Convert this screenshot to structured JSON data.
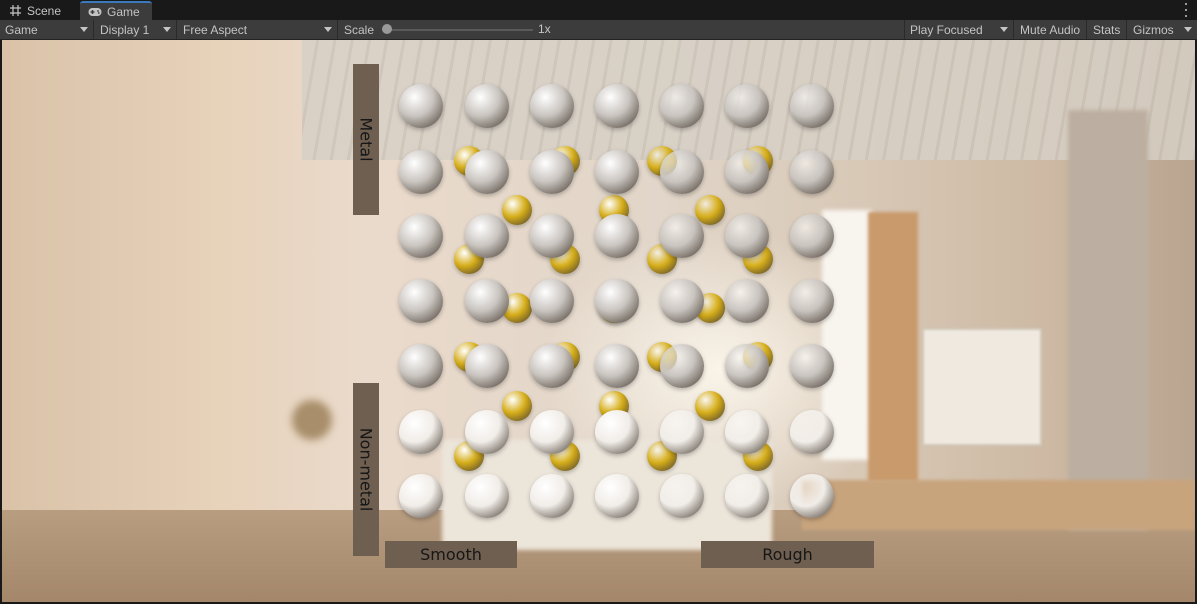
{
  "tabs": {
    "scene": {
      "label": "Scene",
      "icon": "grid-icon"
    },
    "game": {
      "label": "Game",
      "icon": "gamepad-icon"
    }
  },
  "toolbar": {
    "game_mode": "Game",
    "display": "Display 1",
    "aspect": "Free Aspect",
    "scale_label": "Scale",
    "scale_value": "1x",
    "play_mode": "Play Focused",
    "mute_audio": "Mute Audio",
    "stats": "Stats",
    "gizmos": "Gizmos"
  },
  "scene": {
    "label_metal": "Metal",
    "label_nonmetal": "Non-metal",
    "label_smooth": "Smooth",
    "label_rough": "Rough",
    "grid": {
      "columns": 7,
      "rows": 7,
      "colors": {
        "chrome": "#c9c4bf",
        "gold": "#d6ae1a",
        "white": "#f1ede8"
      }
    }
  },
  "colors": {
    "tab_active_accent": "#3a79bb",
    "toolbar_bg": "#3c3c3c",
    "label_panel": "#6f5f51"
  }
}
